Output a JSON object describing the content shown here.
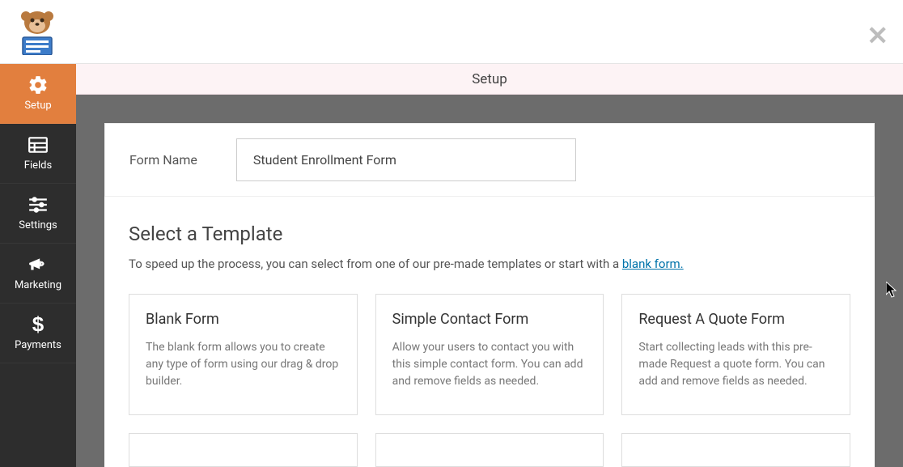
{
  "header": {
    "close_label": "✕"
  },
  "sidebar": {
    "items": [
      {
        "label": "Setup"
      },
      {
        "label": "Fields"
      },
      {
        "label": "Settings"
      },
      {
        "label": "Marketing"
      },
      {
        "label": "Payments"
      }
    ]
  },
  "secondary_header": {
    "title": "Setup"
  },
  "form_name": {
    "label": "Form Name",
    "value": "Student Enrollment Form"
  },
  "templates": {
    "title": "Select a Template",
    "desc_prefix": "To speed up the process, you can select from one of our pre-made templates or start with a ",
    "desc_link": "blank form.",
    "cards": [
      {
        "title": "Blank Form",
        "desc": "The blank form allows you to create any type of form using our drag & drop builder."
      },
      {
        "title": "Simple Contact Form",
        "desc": "Allow your users to contact you with this simple contact form. You can add and remove fields as needed."
      },
      {
        "title": "Request A Quote Form",
        "desc": "Start collecting leads with this pre-made Request a quote form. You can add and remove fields as needed."
      }
    ]
  }
}
